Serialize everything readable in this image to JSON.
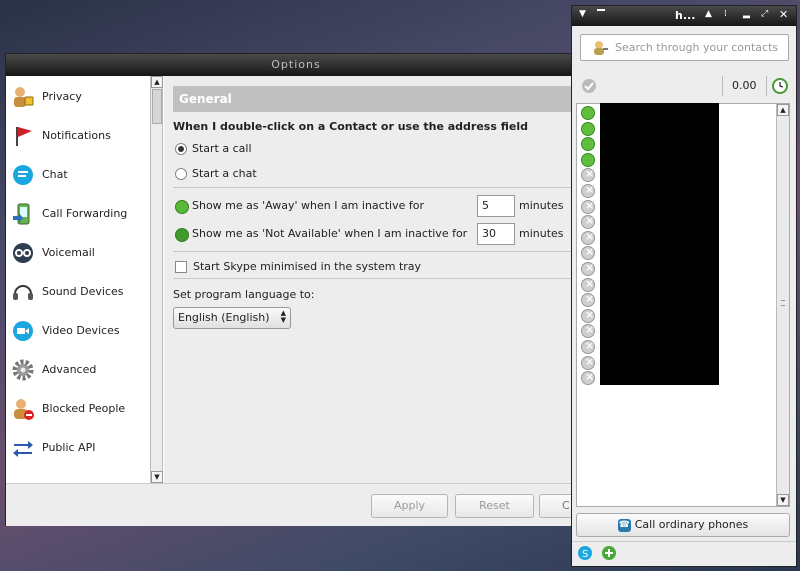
{
  "options": {
    "title": "Options",
    "categories": [
      {
        "label": "Privacy",
        "icon": "privacy-icon"
      },
      {
        "label": "Notifications",
        "icon": "flag-icon"
      },
      {
        "label": "Chat",
        "icon": "chat-icon"
      },
      {
        "label": "Call Forwarding",
        "icon": "call-forwarding-icon"
      },
      {
        "label": "Voicemail",
        "icon": "voicemail-icon"
      },
      {
        "label": "Sound Devices",
        "icon": "headset-icon"
      },
      {
        "label": "Video Devices",
        "icon": "video-camera-icon"
      },
      {
        "label": "Advanced",
        "icon": "gear-icon"
      },
      {
        "label": "Blocked People",
        "icon": "blocked-user-icon"
      },
      {
        "label": "Public API",
        "icon": "api-arrows-icon"
      }
    ],
    "section_title": "General",
    "doubleclick_heading": "When I double-click on a Contact or use the address field",
    "radio_start_call": "Start a call",
    "radio_start_chat": "Start a chat",
    "away_label": "Show me as 'Away' when I am inactive for",
    "away_value": "5",
    "away_unit": "minutes",
    "na_label": "Show me as 'Not Available' when I am inactive for",
    "na_value": "30",
    "na_unit": "minutes",
    "minimised_label": "Start Skype minimised in the system tray",
    "language_label": "Set program language to:",
    "language_value": "English (English)",
    "buttons": {
      "apply": "Apply",
      "reset": "Reset",
      "close": "C"
    }
  },
  "skype": {
    "title": "h...",
    "search_placeholder": "Search through your contacts",
    "credit": "0.00",
    "call_phones": "Call ordinary phones",
    "contact_statuses": [
      "online",
      "online",
      "online",
      "online",
      "offline",
      "offline",
      "offline",
      "offline",
      "offline",
      "offline",
      "offline",
      "offline",
      "offline",
      "offline",
      "offline",
      "offline",
      "offline",
      "offline"
    ]
  }
}
